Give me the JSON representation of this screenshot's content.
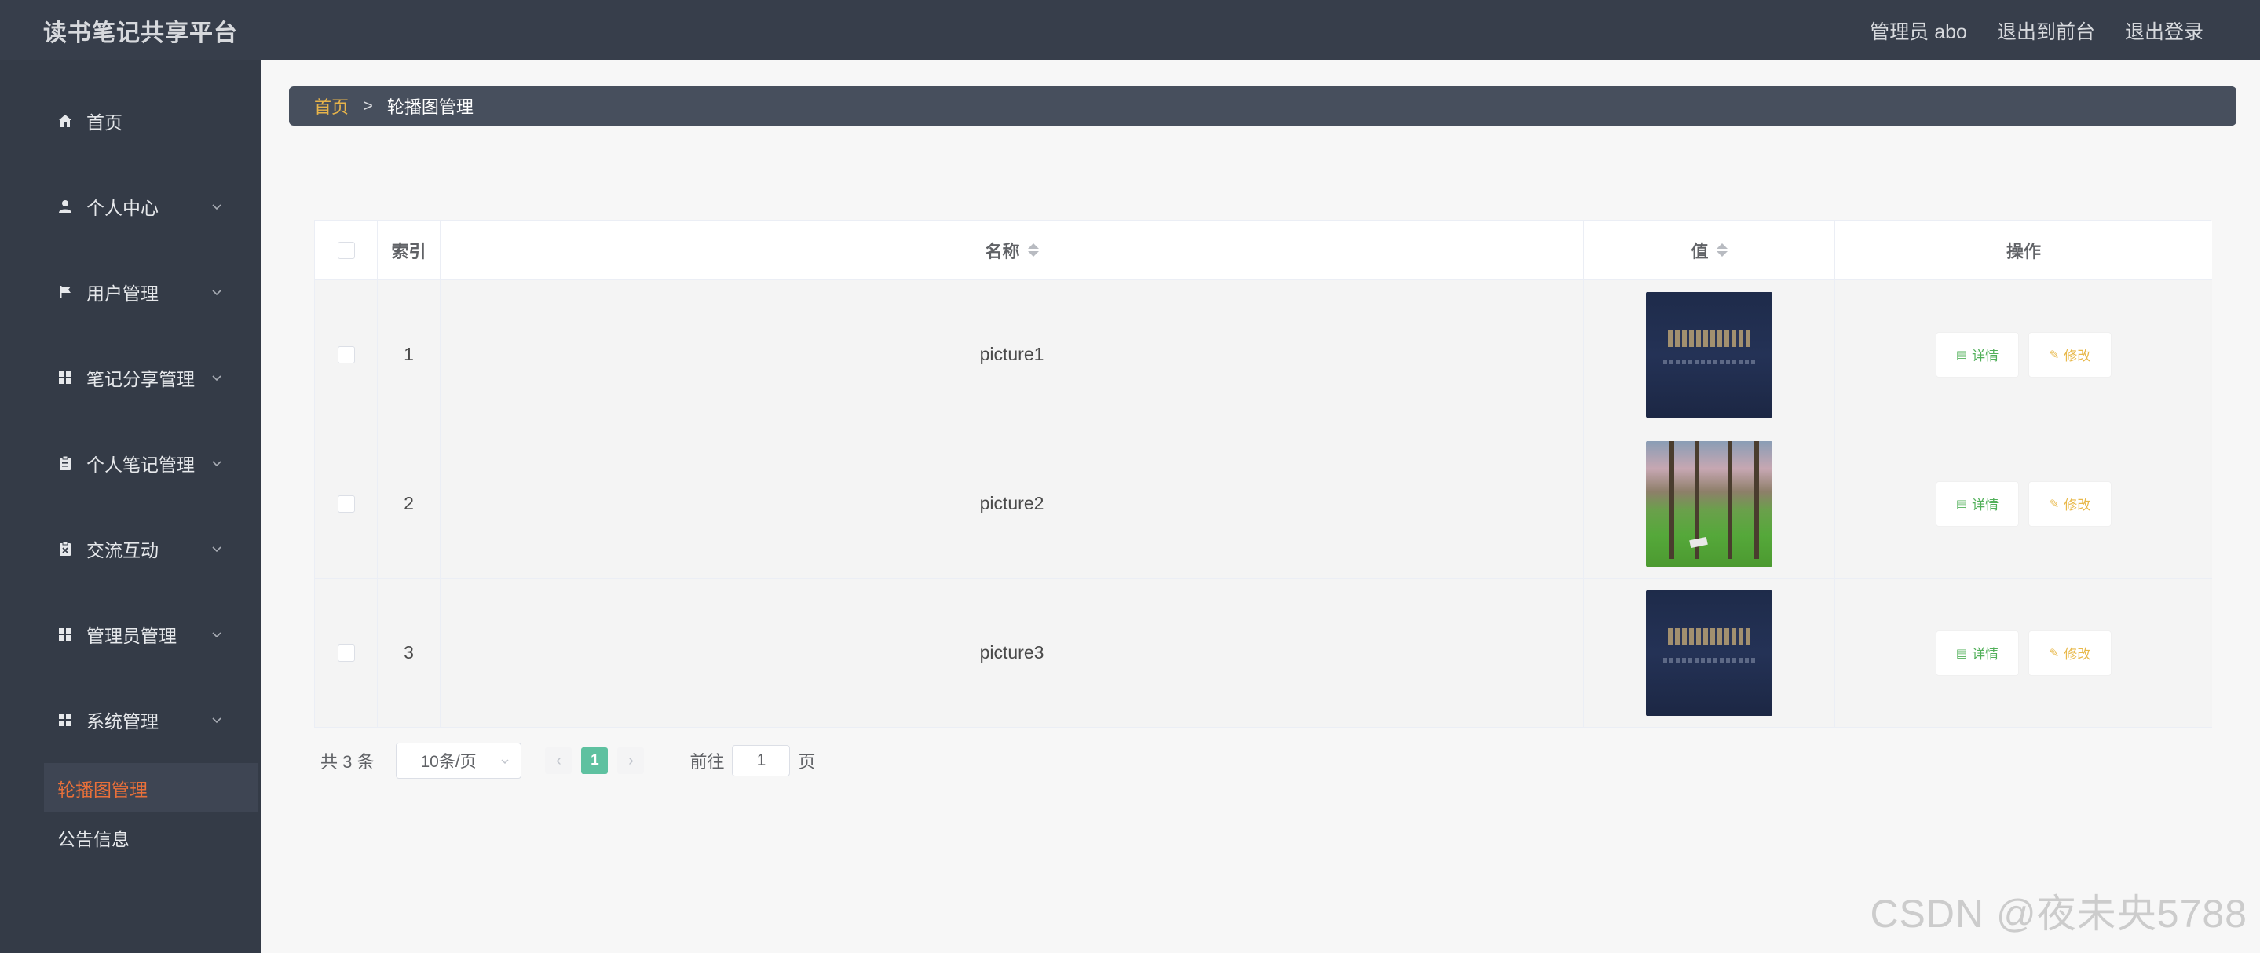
{
  "header": {
    "brand": "读书笔记共享平台",
    "admin": "管理员 abo",
    "to_front": "退出到前台",
    "logout": "退出登录"
  },
  "sidebar": {
    "items": [
      {
        "label": "首页",
        "icon": "home-icon"
      },
      {
        "label": "个人中心",
        "icon": "person-icon"
      },
      {
        "label": "用户管理",
        "icon": "flag-icon"
      },
      {
        "label": "笔记分享管理",
        "icon": "grid-icon"
      },
      {
        "label": "个人笔记管理",
        "icon": "clipboard-icon"
      },
      {
        "label": "交流互动",
        "icon": "clipboard-x-icon"
      },
      {
        "label": "管理员管理",
        "icon": "grid-icon"
      },
      {
        "label": "系统管理",
        "icon": "grid-icon"
      }
    ],
    "subitems": [
      {
        "label": "轮播图管理",
        "active": true
      },
      {
        "label": "公告信息",
        "active": false
      }
    ]
  },
  "breadcrumb": {
    "home": "首页",
    "separator": ">",
    "current": "轮播图管理"
  },
  "table": {
    "columns": {
      "index": "索引",
      "name": "名称",
      "value": "值",
      "actions": "操作"
    },
    "rows": [
      {
        "index": "1",
        "name": "picture1",
        "thumb": "dark-banner-thumb"
      },
      {
        "index": "2",
        "name": "picture2",
        "thumb": "park-lawn-thumb"
      },
      {
        "index": "3",
        "name": "picture3",
        "thumb": "dark-banner-thumb"
      }
    ],
    "detail_label": "详情",
    "edit_label": "修改"
  },
  "pagination": {
    "total": "共 3 条",
    "page_size": "10条/页",
    "current_page": "1",
    "goto_label": "前往",
    "goto_value": "1",
    "page_suffix": "页"
  },
  "watermark": "CSDN @夜未央5788",
  "colors": {
    "header_bg": "#373e4b",
    "sidebar_bg": "#343b47",
    "active_sub": "#e8703a",
    "breadcrumb_home": "#e8b44a",
    "page_active": "#5ec1a0",
    "detail": "#52b05a",
    "edit": "#e8b84a"
  }
}
